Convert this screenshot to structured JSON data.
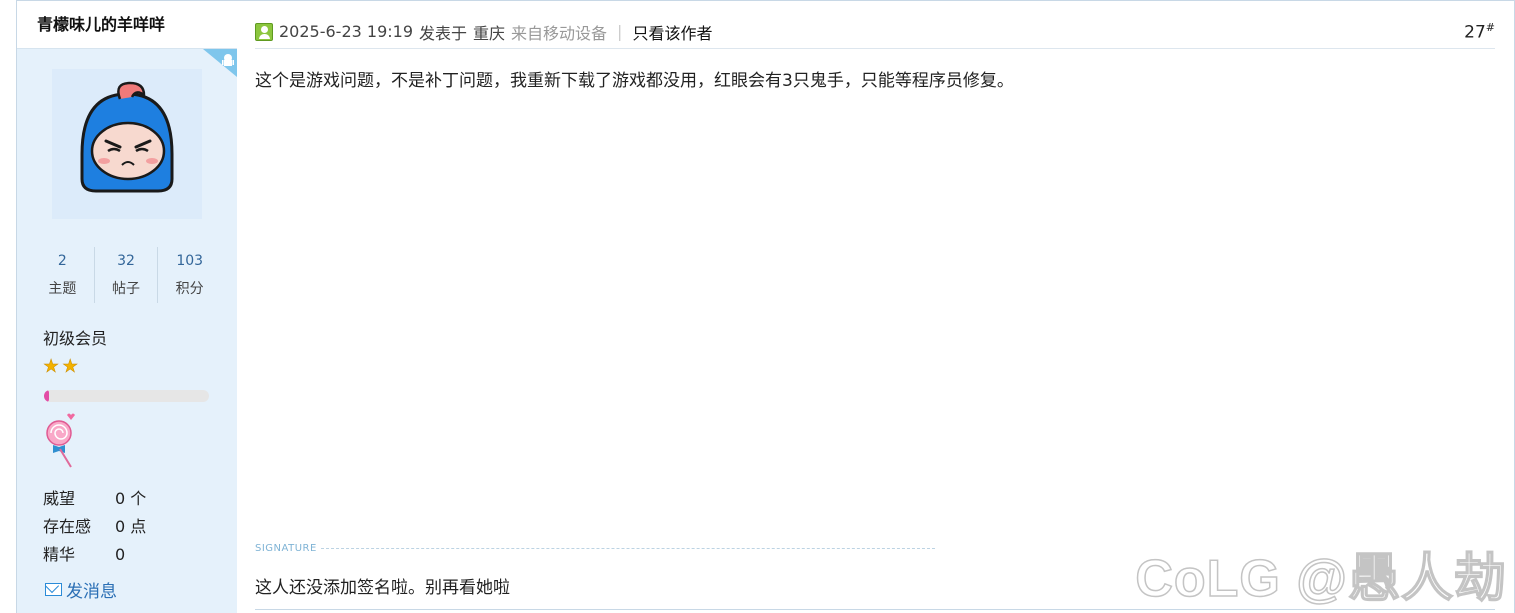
{
  "user": {
    "name": "青檬味儿的羊咩咩",
    "stats": [
      {
        "value": "2",
        "label": "主题"
      },
      {
        "value": "32",
        "label": "帖子"
      },
      {
        "value": "103",
        "label": "积分"
      }
    ],
    "rank": "初级会员",
    "star_count": 2,
    "progress_fraction": 0.03,
    "info": [
      {
        "key": "威望",
        "value": "0 个"
      },
      {
        "key": "存在感",
        "value": "0 点"
      },
      {
        "key": "精华",
        "value": "0"
      }
    ],
    "send_message": "发消息"
  },
  "post": {
    "datetime": "2025-6-23 19:19",
    "posted_in": "发表于",
    "location": "重庆",
    "device": "来自移动设备",
    "separator": "|",
    "author_only": "只看该作者",
    "floor_number": "27",
    "floor_mark": "#",
    "body": "这个是游戏问题，不是补丁问题，我重新下载了游戏都没用，红眼会有3只鬼手，只能等程序员修复。",
    "signature_label": "SIGNATURE",
    "signature_text": "这人还没添加签名啦。别再看她啦"
  },
  "watermark": "CoLG @愚人劫",
  "colors": {
    "sidebar_bg": "#e5f1fb",
    "link_blue": "#2a6fb5",
    "progress_pink": "#e24ca6",
    "star_gold": "#f3b200"
  }
}
